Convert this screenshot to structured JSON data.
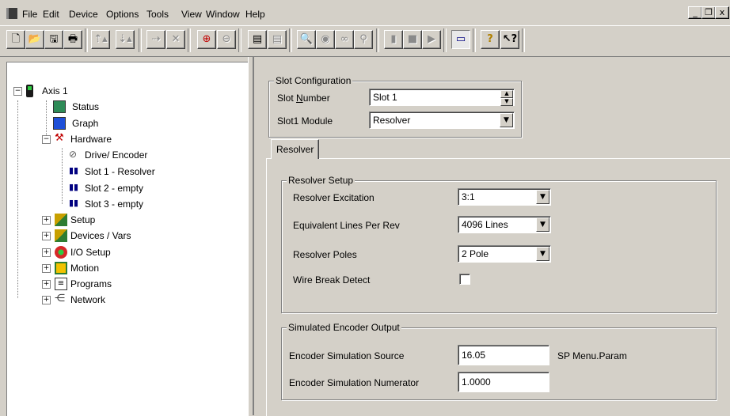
{
  "menubar": {
    "items": [
      "File",
      "Edit",
      "Device",
      "Options",
      "Tools",
      "View",
      "Window",
      "Help"
    ],
    "window_controls": [
      "_",
      "ð",
      "x"
    ]
  },
  "toolbar": {
    "buttons": [
      {
        "icon": "new-file-icon",
        "glyph": "🗋",
        "enabled": true
      },
      {
        "icon": "open-folder-icon",
        "glyph": "📂",
        "enabled": true
      },
      {
        "icon": "save-icon",
        "glyph": "🖫",
        "enabled": true
      },
      {
        "icon": "print-icon",
        "glyph": "🖶",
        "enabled": true
      },
      {
        "icon": "upload-icon",
        "glyph": "⇡",
        "enabled": false
      },
      {
        "icon": "download-icon",
        "glyph": "⇣",
        "enabled": false
      },
      {
        "icon": "connect-icon",
        "glyph": "⇢",
        "enabled": false
      },
      {
        "icon": "disconnect-icon",
        "glyph": "✕",
        "enabled": false
      },
      {
        "icon": "add-axis-icon",
        "glyph": "⊕",
        "enabled": true
      },
      {
        "icon": "remove-axis-icon",
        "glyph": "⊖",
        "enabled": false
      },
      {
        "icon": "properties-icon",
        "glyph": "▤",
        "enabled": true
      },
      {
        "icon": "properties-disabled-icon",
        "glyph": "▤",
        "enabled": false
      },
      {
        "icon": "zoom-icon",
        "glyph": "🔍",
        "enabled": false
      },
      {
        "icon": "run-icon",
        "glyph": "◉",
        "enabled": false
      },
      {
        "icon": "glasses-icon",
        "glyph": "∞",
        "enabled": false
      },
      {
        "icon": "watch-icon",
        "glyph": "⚲",
        "enabled": false
      },
      {
        "icon": "device-icon",
        "glyph": "▮",
        "enabled": false
      },
      {
        "icon": "stop-icon",
        "glyph": "■",
        "enabled": false
      },
      {
        "icon": "step-icon",
        "glyph": "▶",
        "enabled": false
      },
      {
        "icon": "window-icon",
        "glyph": "▭",
        "enabled": true,
        "pressed": true
      },
      {
        "icon": "help-icon",
        "glyph": "?",
        "enabled": true
      },
      {
        "icon": "context-help-icon",
        "glyph": "↖?",
        "enabled": true
      }
    ]
  },
  "tree": {
    "root": "Axis 1",
    "items": [
      {
        "label": "Status",
        "icon": "status-icon"
      },
      {
        "label": "Graph",
        "icon": "graph-icon"
      },
      {
        "label": "Hardware",
        "icon": "hardware-icon"
      },
      {
        "label": "Drive/ Encoder",
        "icon": "drive-encoder-icon"
      },
      {
        "label": "Slot 1 - Resolver",
        "icon": "slot-icon"
      },
      {
        "label": "Slot 2 - empty",
        "icon": "slot-icon"
      },
      {
        "label": "Slot 3 - empty",
        "icon": "slot-icon"
      },
      {
        "label": "Setup",
        "icon": "setup-icon"
      },
      {
        "label": "Devices / Vars",
        "icon": "devices-icon"
      },
      {
        "label": "I/O Setup",
        "icon": "io-icon"
      },
      {
        "label": "Motion",
        "icon": "motion-icon"
      },
      {
        "label": "Programs",
        "icon": "programs-icon"
      },
      {
        "label": "Network",
        "icon": "network-icon"
      }
    ]
  },
  "slot_config": {
    "legend": "Slot Configuration",
    "number_label_pre": "Slot ",
    "number_label_ul": "N",
    "number_label_post": "umber",
    "number_value": "Slot 1",
    "module_label": "Slot1 Module",
    "module_value": "Resolver"
  },
  "tab": {
    "label": "Resolver"
  },
  "resolver_setup": {
    "legend": "Resolver Setup",
    "excitation_label": "Resolver Excitation",
    "excitation_value": "3:1",
    "lines_label": "Equivalent Lines Per Rev",
    "lines_value": "4096 Lines",
    "poles_label": "Resolver Poles",
    "poles_value": "2 Pole",
    "wire_break_label": "Wire Break Detect",
    "wire_break_checked": false
  },
  "sim_encoder": {
    "legend": "Simulated Encoder Output",
    "source_label": "Encoder Simulation Source",
    "source_value": "16.05",
    "source_hint": "SP Menu.Param",
    "numerator_label": "Encoder Simulation Numerator",
    "numerator_value": "1.0000"
  }
}
